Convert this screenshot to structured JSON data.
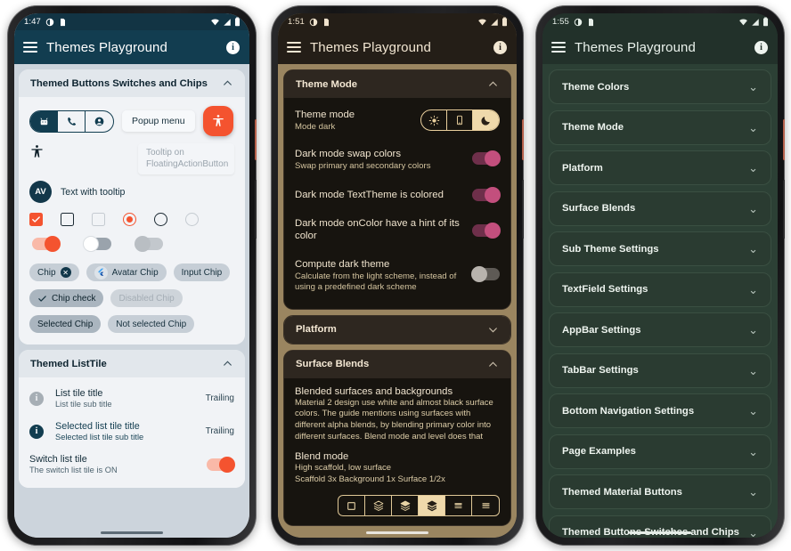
{
  "phone1": {
    "status": {
      "time": "1:47",
      "icons": [
        "clock-half-icon",
        "sim-icon"
      ],
      "right_icons": [
        "wifi-icon",
        "signal-icon",
        "battery-icon"
      ]
    },
    "appbar": {
      "title": "Themes Playground",
      "menu_icon": "hamburger-menu-icon",
      "info_icon": "info-icon",
      "info_label": "i"
    },
    "cards": [
      {
        "title": "Themed Buttons Switches and Chips",
        "expanded": true,
        "chevron": "chevron-up-icon",
        "popup_menu_label": "Popup menu",
        "tooltip_text": "Tooltip on FloatingActionButton",
        "avatar_initials": "AV",
        "avatar_label": "Text with tooltip",
        "toggle_icons": [
          "android-icon",
          "phone-icon",
          "account-icon"
        ],
        "fab_icon": "accessibility-icon",
        "accessibility_icon": "accessibility-icon",
        "checkboxes": [
          {
            "name": "checkbox-checked",
            "state": "checked"
          },
          {
            "name": "checkbox-unchecked",
            "state": "unchecked"
          },
          {
            "name": "checkbox-disabled",
            "state": "disabled"
          }
        ],
        "radios": [
          {
            "name": "radio-selected",
            "state": "selected"
          },
          {
            "name": "radio-unselected",
            "state": "unselected"
          },
          {
            "name": "radio-disabled",
            "state": "disabled"
          }
        ],
        "switches": [
          {
            "name": "switch-on",
            "state": "on"
          },
          {
            "name": "switch-off",
            "state": "off"
          },
          {
            "name": "switch-disabled",
            "state": "disabled"
          }
        ],
        "chips_row1": [
          {
            "label": "Chip",
            "icon": "close-circle-icon",
            "state": "normal"
          },
          {
            "label": "Avatar Chip",
            "icon": "flutter-logo-icon",
            "state": "normal"
          },
          {
            "label": "Input Chip",
            "icon": "",
            "state": "normal"
          }
        ],
        "chips_row2": [
          {
            "label": "Chip check",
            "icon": "check-icon",
            "state": "selected"
          },
          {
            "label": "Disabled Chip",
            "icon": "",
            "state": "disabled"
          }
        ],
        "chips_row3": [
          {
            "label": "Selected Chip",
            "icon": "",
            "state": "selected"
          },
          {
            "label": "Not selected Chip",
            "icon": "",
            "state": "normal"
          }
        ]
      },
      {
        "title": "Themed ListTile",
        "expanded": true,
        "chevron": "chevron-up-icon",
        "tiles": [
          {
            "lead_icon": "info-icon",
            "lead_label": "i",
            "title": "List tile title",
            "subtitle": "List tile sub title",
            "trailing": "Trailing",
            "selected": false
          },
          {
            "lead_icon": "info-icon",
            "lead_label": "i",
            "title": "Selected list tile title",
            "subtitle": "Selected list tile sub title",
            "trailing": "Trailing",
            "selected": true
          }
        ],
        "switch_tile": {
          "title": "Switch list tile",
          "subtitle": "The switch list tile is ON",
          "state": "on"
        }
      }
    ]
  },
  "phone2": {
    "status": {
      "time": "1:51",
      "icons": [
        "clock-half-icon",
        "sim-icon"
      ],
      "right_icons": [
        "wifi-icon",
        "signal-icon",
        "battery-icon"
      ]
    },
    "appbar": {
      "title": "Themes Playground",
      "menu_icon": "hamburger-menu-icon",
      "info_icon": "info-icon",
      "info_label": "i"
    },
    "theme_mode_card": {
      "title": "Theme Mode",
      "expanded": true,
      "chevron": "chevron-up-icon",
      "rows": [
        {
          "title": "Theme mode",
          "subtitle": "Mode dark",
          "control": "segmented",
          "options": [
            "light-mode-icon",
            "system-mode-icon",
            "dark-mode-icon"
          ],
          "selected_index": 2
        },
        {
          "title": "Dark mode swap colors",
          "subtitle": "Swap primary and secondary colors",
          "control": "switch",
          "state": "on"
        },
        {
          "title": "Dark mode TextTheme is colored",
          "subtitle": "",
          "control": "switch",
          "state": "on"
        },
        {
          "title": "Dark mode onColor have a hint of its color",
          "subtitle": "",
          "control": "switch",
          "state": "on"
        },
        {
          "title": "Compute dark theme",
          "subtitle": "Calculate from the light scheme, instead of using a predefined dark scheme",
          "control": "switch",
          "state": "off"
        }
      ]
    },
    "platform_card": {
      "title": "Platform",
      "expanded": false,
      "chevron": "chevron-down-icon"
    },
    "surface_card": {
      "title": "Surface Blends",
      "expanded": true,
      "chevron": "chevron-up-icon",
      "heading": "Blended surfaces and backgrounds",
      "paragraph": "Material 2 design use white and almost black surface colors. The guide mentions using surfaces with different alpha blends, by blending primary color into different surfaces. Blend mode and level does that",
      "blend_heading": "Blend mode",
      "blend_value": "High scaffold, low surface",
      "blend_detail": "Scaffold 3x  Background 1x  Surface 1/2x",
      "blend_options": [
        "square-outline-icon",
        "layers-outline-icon",
        "layers-half-icon",
        "layers-filled-icon",
        "lines-split-icon",
        "lines-stack-icon"
      ],
      "blend_selected_index": 3
    }
  },
  "phone3": {
    "status": {
      "time": "1:55",
      "icons": [
        "clock-half-icon",
        "sim-icon"
      ],
      "right_icons": [
        "wifi-icon",
        "signal-icon",
        "battery-icon"
      ]
    },
    "appbar": {
      "title": "Themes Playground",
      "menu_icon": "hamburger-menu-icon",
      "info_icon": "info-icon",
      "info_label": "i"
    },
    "sections": [
      {
        "title": "Theme Colors",
        "chevron": "chevron-down-icon"
      },
      {
        "title": "Theme Mode",
        "chevron": "chevron-down-icon"
      },
      {
        "title": "Platform",
        "chevron": "chevron-down-icon"
      },
      {
        "title": "Surface Blends",
        "chevron": "chevron-down-icon"
      },
      {
        "title": "Sub Theme Settings",
        "chevron": "chevron-down-icon"
      },
      {
        "title": "TextField Settings",
        "chevron": "chevron-down-icon"
      },
      {
        "title": "AppBar Settings",
        "chevron": "chevron-down-icon"
      },
      {
        "title": "TabBar Settings",
        "chevron": "chevron-down-icon"
      },
      {
        "title": "Bottom Navigation Settings",
        "chevron": "chevron-down-icon"
      },
      {
        "title": "Page Examples",
        "chevron": "chevron-down-icon"
      },
      {
        "title": "Themed Material Buttons",
        "chevron": "chevron-down-icon"
      },
      {
        "title": "Themed Buttons Switches and Chips",
        "chevron": "chevron-down-icon"
      }
    ]
  },
  "colors": {
    "page_background": "#ffffff",
    "phone1_appbar": "#123d50",
    "phone1_accent": "#f4532f",
    "phone1_scaffold": "#ccd4dc",
    "phone2_appbar": "#241e17",
    "phone2_accent": "#efd9ab",
    "phone2_switch": "#c34f7d",
    "phone2_scaffold": "#9a8560",
    "phone3_appbar": "#22312a",
    "phone3_scaffold": "#2c4035",
    "phone3_card": "#2a3b31"
  }
}
